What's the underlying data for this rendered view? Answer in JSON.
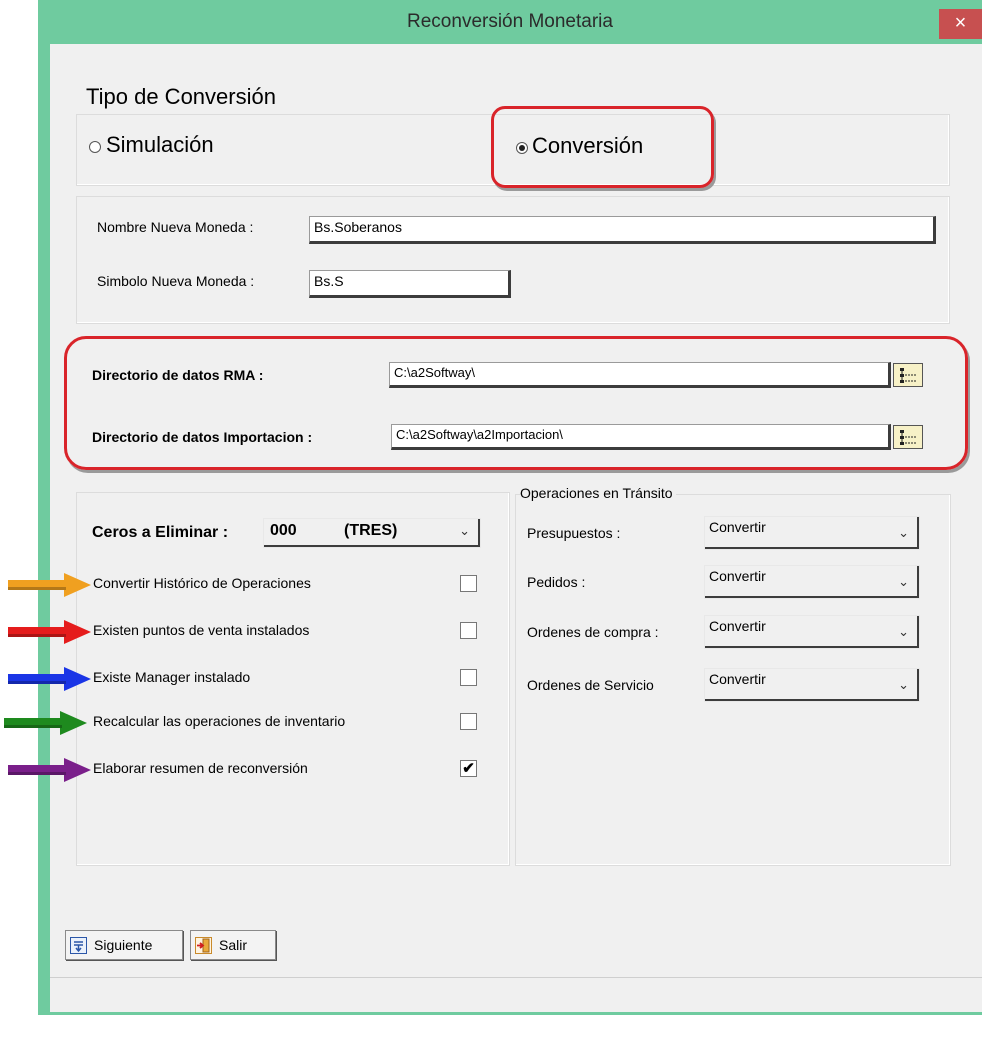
{
  "window": {
    "title": "Reconversión Monetaria",
    "close_glyph": "×"
  },
  "tipo": {
    "heading": "Tipo de Conversión",
    "simulacion_label": "Simulación",
    "conversion_label": "Conversión",
    "selected": "Conversión"
  },
  "moneda": {
    "nombre_label": "Nombre Nueva Moneda :",
    "nombre_value": "Bs.Soberanos",
    "simbolo_label": "Simbolo Nueva Moneda :",
    "simbolo_value": "Bs.S"
  },
  "directorios": {
    "rma_label": "Directorio de datos RMA :",
    "rma_value": "C:\\a2Softway\\",
    "import_label": "Directorio de datos Importacion :",
    "import_value": "C:\\a2Softway\\a2Importacion\\"
  },
  "ceros": {
    "label": "Ceros a Eliminar :",
    "value": "000",
    "value_text": "(TRES)"
  },
  "options": [
    {
      "label": "Convertir Histórico de Operaciones",
      "checked": false,
      "arrow_color": "#f0a020"
    },
    {
      "label": "Existen puntos de venta instalados",
      "checked": false,
      "arrow_color": "#e51c1c"
    },
    {
      "label": "Existe Manager  instalado",
      "checked": false,
      "arrow_color": "#1a35e6"
    },
    {
      "label": "Recalcular las operaciones de inventario",
      "checked": false,
      "arrow_color": "#1e8a1e"
    },
    {
      "label": "Elaborar resumen de reconversión",
      "checked": true,
      "arrow_color": "#7a1f8a"
    }
  ],
  "transito": {
    "heading": "Operaciones en Tránsito",
    "rows": [
      {
        "label": "Presupuestos :",
        "value": "Convertir"
      },
      {
        "label": "Pedidos :",
        "value": "Convertir"
      },
      {
        "label": "Ordenes de compra :",
        "value": "Convertir"
      },
      {
        "label": "Ordenes de Servicio",
        "value": "Convertir"
      }
    ]
  },
  "buttons": {
    "siguiente": "Siguiente",
    "salir": "Salir"
  },
  "colors": {
    "window_frame": "#6fcb9f",
    "highlight": "#d9242a",
    "close": "#c75050"
  }
}
